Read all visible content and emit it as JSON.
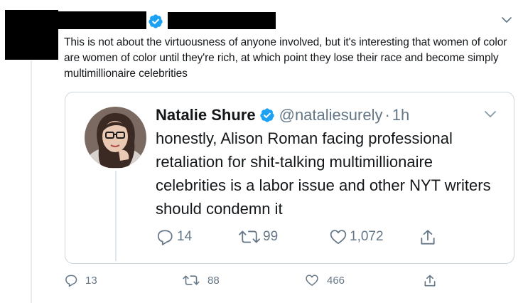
{
  "outer_tweet": {
    "text": "This is not about the virtuousness of anyone involved, but it's interesting that women of color are women of color until they're rich, at which point they lose their race and become simply multimillionaire celebrities",
    "actions": {
      "replies": "13",
      "retweets": "88",
      "likes": "466"
    }
  },
  "quoted_tweet": {
    "name": "Natalie Shure",
    "handle": "@nataliesurely",
    "separator": "·",
    "time": "1h",
    "text": "honestly, Alison Roman facing professional retaliation for shit-talking multimillionaire celebrities is a labor issue and other NYT writers should condemn it",
    "actions": {
      "replies": "14",
      "retweets": "99",
      "likes": "1,072"
    }
  },
  "icons": {
    "verified": "verified-badge-icon",
    "caret": "chevron-down-icon",
    "reply": "reply-icon",
    "retweet": "retweet-icon",
    "like": "heart-icon",
    "share": "share-icon"
  },
  "colors": {
    "verified_blue": "#1da1f2",
    "text": "#14171a",
    "secondary": "#657786",
    "border": "#ccd6dd"
  }
}
